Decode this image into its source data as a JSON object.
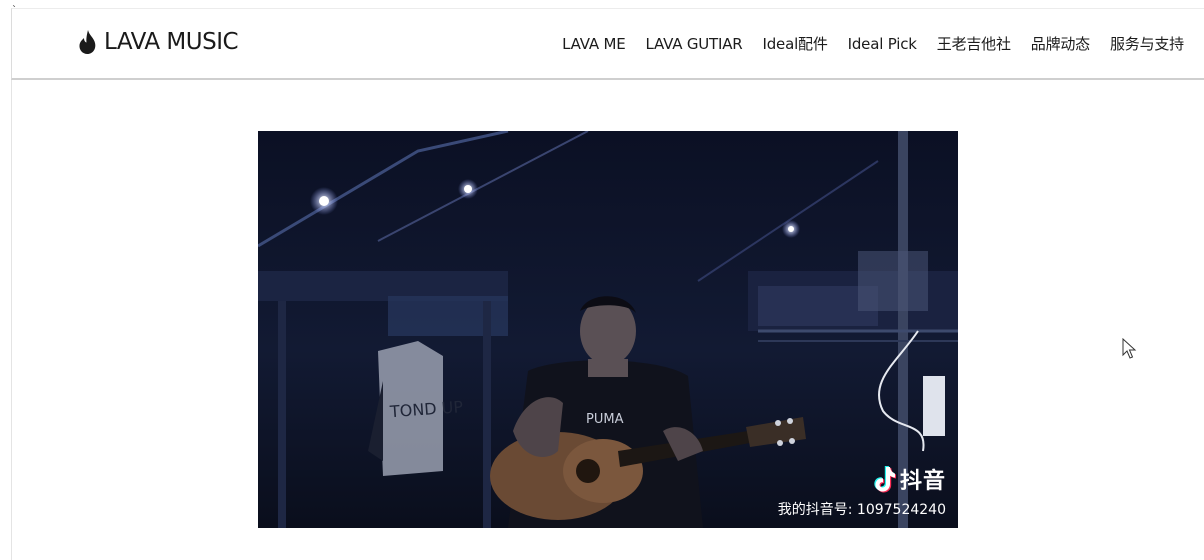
{
  "stray_mark": "`",
  "brand": {
    "name": "LAVA MUSIC",
    "logo_icon": "flame-icon",
    "color": "#1a1a1a"
  },
  "nav": {
    "items": [
      {
        "label": "LAVA ME"
      },
      {
        "label": "LAVA GUTIAR"
      },
      {
        "label": "Ideal配件"
      },
      {
        "label": "Ideal Pick"
      },
      {
        "label": "王老吉他社"
      },
      {
        "label": "品牌动态"
      },
      {
        "label": "服务与支持"
      }
    ]
  },
  "video": {
    "watermark_brand": "抖音",
    "watermark_icon": "tiktok-note-icon",
    "watermark_id": "我的抖音号: 1097524240"
  },
  "colors": {
    "video_background": "#0a0f1d",
    "header_border": "#cfcfcf"
  },
  "cursor": {
    "icon": "mouse-pointer-icon"
  }
}
